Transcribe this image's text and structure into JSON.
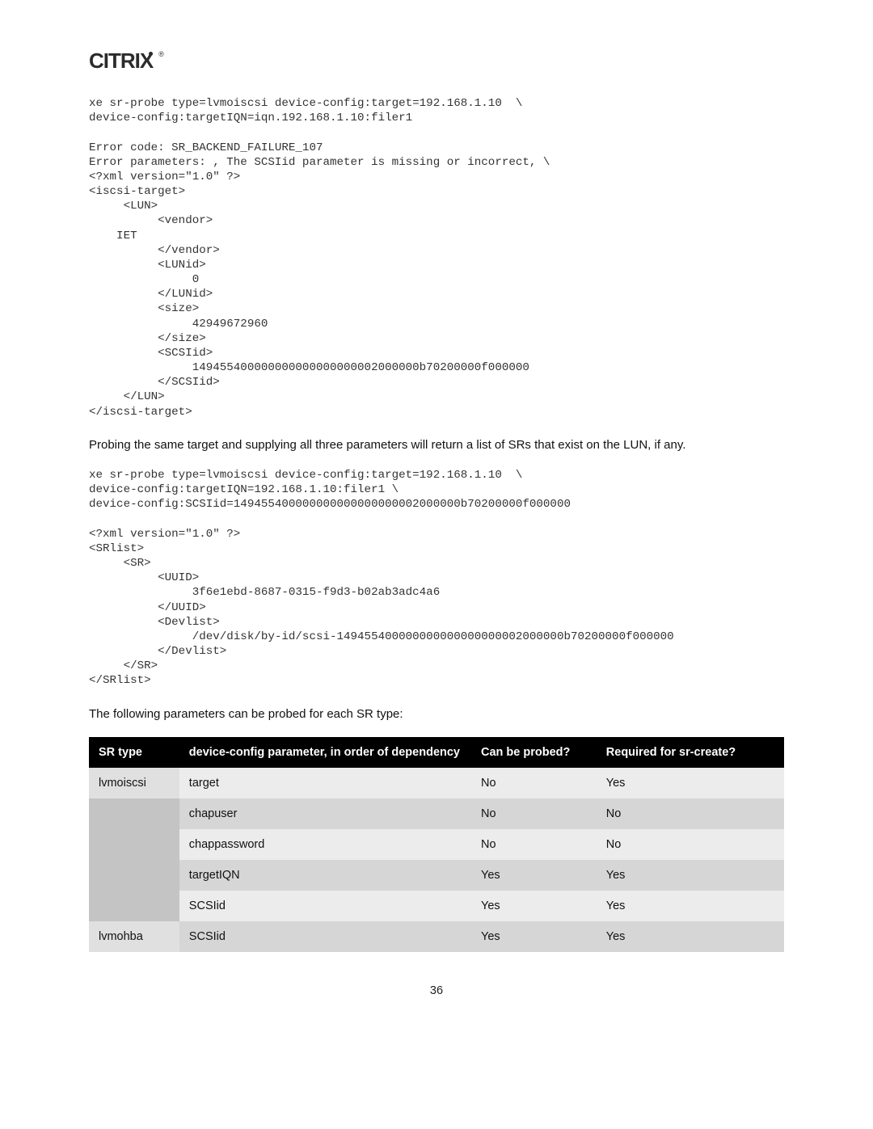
{
  "logo": {
    "text": "CITRIX",
    "reg": "®"
  },
  "code_block_1": "xe sr-probe type=lvmoiscsi device-config:target=192.168.1.10  \\\ndevice-config:targetIQN=iqn.192.168.1.10:filer1\n\nError code: SR_BACKEND_FAILURE_107\nError parameters: , The SCSIid parameter is missing or incorrect, \\\n<?xml version=\"1.0\" ?>\n<iscsi-target>\n     <LUN>\n          <vendor>\n    IET\n          </vendor>\n          <LUNid>\n               0\n          </LUNid>\n          <size>\n               42949672960\n          </size>\n          <SCSIid>\n               149455400000000000000000002000000b70200000f000000\n          </SCSIid>\n     </LUN>\n</iscsi-target>",
  "para_1": "Probing the same target and supplying all three parameters will return a list of SRs that exist on the LUN, if any.",
  "code_block_2": "xe sr-probe type=lvmoiscsi device-config:target=192.168.1.10  \\\ndevice-config:targetIQN=192.168.1.10:filer1 \\\ndevice-config:SCSIid=149455400000000000000000002000000b70200000f000000\n\n<?xml version=\"1.0\" ?>\n<SRlist>\n     <SR>\n          <UUID>\n               3f6e1ebd-8687-0315-f9d3-b02ab3adc4a6\n          </UUID>\n          <Devlist>\n               /dev/disk/by-id/scsi-149455400000000000000000002000000b70200000f000000\n          </Devlist>\n     </SR>\n</SRlist>",
  "para_2": "The following parameters can be probed for each SR type:",
  "table": {
    "headers": {
      "sr_type": "SR type",
      "device_config": "device-config parameter, in order of dependency",
      "can_probe": "Can be probed?",
      "required": "Required for sr-create?"
    },
    "rows": [
      {
        "sr_type": "lvmoiscsi",
        "dc": "target",
        "cp": "No",
        "req": "Yes",
        "shade": "light",
        "first": true
      },
      {
        "sr_type": "",
        "dc": "chapuser",
        "cp": "No",
        "req": "No",
        "shade": "dark",
        "first": false
      },
      {
        "sr_type": "",
        "dc": "chappassword",
        "cp": "No",
        "req": "No",
        "shade": "light",
        "first": false
      },
      {
        "sr_type": "",
        "dc": "targetIQN",
        "cp": "Yes",
        "req": "Yes",
        "shade": "dark",
        "first": false
      },
      {
        "sr_type": "",
        "dc": "SCSIid",
        "cp": "Yes",
        "req": "Yes",
        "shade": "light",
        "first": false
      },
      {
        "sr_type": "lvmohba",
        "dc": "SCSIid",
        "cp": "Yes",
        "req": "Yes",
        "shade": "dark",
        "first": true
      }
    ]
  },
  "page_number": "36"
}
